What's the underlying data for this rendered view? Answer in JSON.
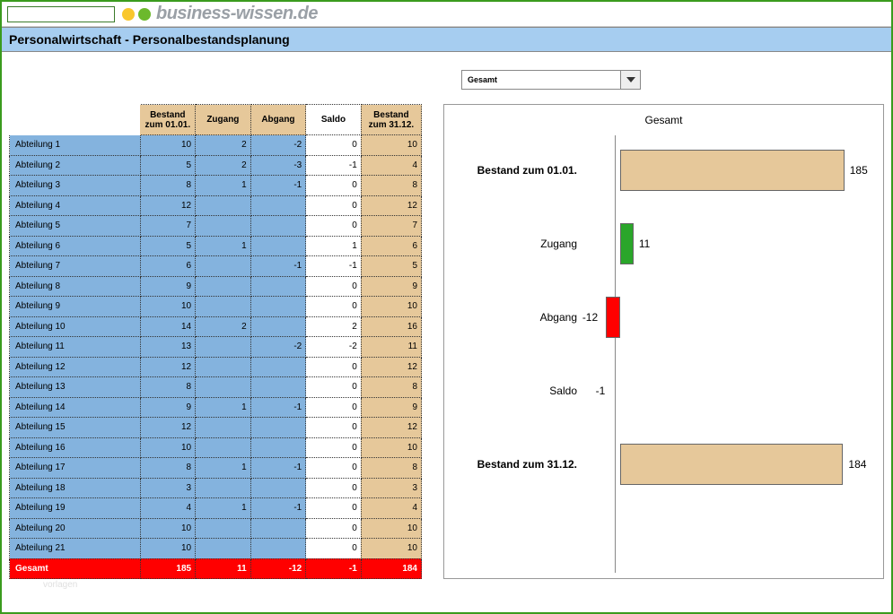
{
  "logo_text": "business-wissen.de",
  "page_title": "Personalwirtschaft - Personalbestandsplanung",
  "dropdown": {
    "selected": "Gesamt"
  },
  "watermark": "vorlagen",
  "table": {
    "headers": {
      "c1": "Bestand zum 01.01.",
      "c2": "Zugang",
      "c3": "Abgang",
      "c4": "Saldo",
      "c5": "Bestand zum 31.12."
    },
    "rows": [
      {
        "label": "Abteilung 1",
        "b1": 10,
        "zu": 2,
        "ab": -2,
        "s": 0,
        "b2": 10
      },
      {
        "label": "Abteilung 2",
        "b1": 5,
        "zu": 2,
        "ab": -3,
        "s": -1,
        "b2": 4
      },
      {
        "label": "Abteilung 3",
        "b1": 8,
        "zu": 1,
        "ab": -1,
        "s": 0,
        "b2": 8
      },
      {
        "label": "Abteilung 4",
        "b1": 12,
        "zu": "",
        "ab": "",
        "s": 0,
        "b2": 12
      },
      {
        "label": "Abteilung 5",
        "b1": 7,
        "zu": "",
        "ab": "",
        "s": 0,
        "b2": 7
      },
      {
        "label": "Abteilung 6",
        "b1": 5,
        "zu": 1,
        "ab": "",
        "s": 1,
        "b2": 6
      },
      {
        "label": "Abteilung 7",
        "b1": 6,
        "zu": "",
        "ab": -1,
        "s": -1,
        "b2": 5
      },
      {
        "label": "Abteilung 8",
        "b1": 9,
        "zu": "",
        "ab": "",
        "s": 0,
        "b2": 9
      },
      {
        "label": "Abteilung 9",
        "b1": 10,
        "zu": "",
        "ab": "",
        "s": 0,
        "b2": 10
      },
      {
        "label": "Abteilung 10",
        "b1": 14,
        "zu": 2,
        "ab": "",
        "s": 2,
        "b2": 16
      },
      {
        "label": "Abteilung 11",
        "b1": 13,
        "zu": "",
        "ab": -2,
        "s": -2,
        "b2": 11
      },
      {
        "label": "Abteilung 12",
        "b1": 12,
        "zu": "",
        "ab": "",
        "s": 0,
        "b2": 12
      },
      {
        "label": "Abteilung 13",
        "b1": 8,
        "zu": "",
        "ab": "",
        "s": 0,
        "b2": 8
      },
      {
        "label": "Abteilung 14",
        "b1": 9,
        "zu": 1,
        "ab": -1,
        "s": 0,
        "b2": 9
      },
      {
        "label": "Abteilung 15",
        "b1": 12,
        "zu": "",
        "ab": "",
        "s": 0,
        "b2": 12
      },
      {
        "label": "Abteilung 16",
        "b1": 10,
        "zu": "",
        "ab": "",
        "s": 0,
        "b2": 10
      },
      {
        "label": "Abteilung 17",
        "b1": 8,
        "zu": 1,
        "ab": -1,
        "s": 0,
        "b2": 8
      },
      {
        "label": "Abteilung 18",
        "b1": 3,
        "zu": "",
        "ab": "",
        "s": 0,
        "b2": 3
      },
      {
        "label": "Abteilung 19",
        "b1": 4,
        "zu": 1,
        "ab": -1,
        "s": 0,
        "b2": 4
      },
      {
        "label": "Abteilung 20",
        "b1": 10,
        "zu": "",
        "ab": "",
        "s": 0,
        "b2": 10
      },
      {
        "label": "Abteilung 21",
        "b1": 10,
        "zu": "",
        "ab": "",
        "s": 0,
        "b2": 10
      }
    ],
    "total": {
      "label": "Gesamt",
      "b1": 185,
      "zu": 11,
      "ab": -12,
      "s": -1,
      "b2": 184
    }
  },
  "chart_data": {
    "type": "bar",
    "title": "Gesamt",
    "orientation": "horizontal",
    "baseline": 0,
    "categories": [
      "Bestand zum 01.01.",
      "Zugang",
      "Abgang",
      "Saldo",
      "Bestand zum 31.12."
    ],
    "values": [
      185,
      11,
      -12,
      -1,
      184
    ],
    "colors": [
      "#e6c89a",
      "#2aa62a",
      "#ff0000",
      null,
      "#e6c89a"
    ],
    "xlim": [
      -15,
      200
    ]
  }
}
